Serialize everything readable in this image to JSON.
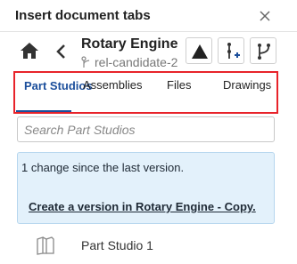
{
  "dialog": {
    "title": "Insert document tabs"
  },
  "document": {
    "name": "Rotary Engine ...",
    "branch": "rel-candidate-2"
  },
  "tabs": [
    {
      "label": "Part Studios",
      "active": true
    },
    {
      "label": "Assemblies",
      "active": false
    },
    {
      "label": "Files",
      "active": false
    },
    {
      "label": "Drawings",
      "active": false
    }
  ],
  "search": {
    "placeholder": "Search Part Studios"
  },
  "info": {
    "message": "1 change since the last version.",
    "link": "Create a version in Rotary Engine - Copy."
  },
  "items": [
    {
      "label": "Part Studio 1",
      "icon": "part-studio-icon"
    }
  ],
  "icons": {
    "close": "close-icon",
    "home": "home-icon",
    "back": "chevron-left-icon",
    "branch": "branch-icon",
    "triangle": "triangle-icon",
    "insert": "insert-version-icon",
    "merge": "branch-merge-icon"
  },
  "colors": {
    "accent": "#1b4e9b",
    "highlight_border": "#e8232a",
    "info_bg": "#e3f1fb"
  }
}
